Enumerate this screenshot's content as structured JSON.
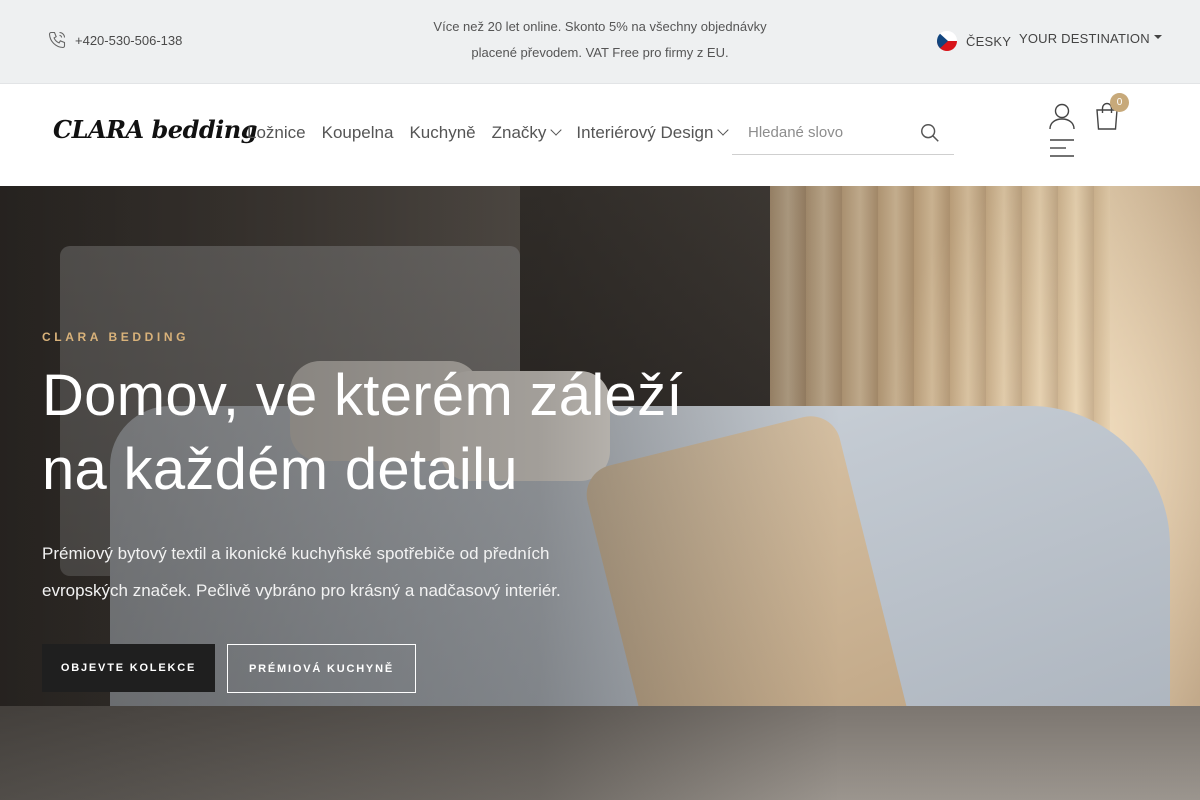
{
  "topbar": {
    "phone": "+420-530-506-138",
    "promo_line1": "Více než 20 let online. Skonto 5% na všechny objednávky",
    "promo_line2": "placené převodem. VAT Free pro firmy z EU.",
    "language": "ČESKY",
    "destination": "YOUR DESTINATION"
  },
  "header": {
    "logo": "CLARA bedding",
    "nav": [
      {
        "label": "Ložnice"
      },
      {
        "label": "Koupelna"
      },
      {
        "label": "Kuchyně"
      },
      {
        "label": "Značky"
      },
      {
        "label": "Interiérový Design"
      }
    ],
    "search_placeholder": "Hledané slovo",
    "cart_count": "0"
  },
  "hero": {
    "eyebrow": "CLARA BEDDING",
    "title_line1": "Domov, ve kterém záleží",
    "title_line2": "na každém detailu",
    "text_line1": "Prémiový bytový textil a ikonické kuchyňské spotřebiče od předních",
    "text_line2": "evropských značek. Pečlivě vybráno pro krásný a nadčasový interiér.",
    "primary_button": "OBJEVTE KOLEKCE",
    "secondary_button": "PRÉMIOVÁ KUCHYNĚ"
  },
  "icons": {
    "phone": "phone-icon",
    "search": "search-icon",
    "user": "user-icon",
    "cart": "cart-icon",
    "menu": "menu-icon"
  },
  "colors": {
    "accent": "#c7a97a",
    "eyebrow": "#d9b27a",
    "topbar_bg": "#eef0f1"
  }
}
